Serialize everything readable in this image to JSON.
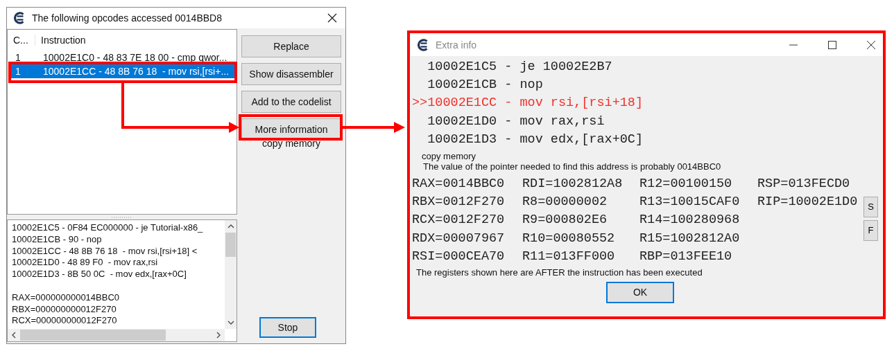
{
  "opcodes_window": {
    "title": "The following opcodes accessed 0014BBD8",
    "columns": [
      "C...",
      "Instruction"
    ],
    "rows": [
      {
        "count": "1",
        "instruction": "10002E1C0 - 48 83 7E 18 00 - cmp qwor...",
        "selected": false
      },
      {
        "count": "1",
        "instruction": "10002E1CC - 48 8B 76 18  - mov rsi,[rsi+...",
        "selected": true
      }
    ],
    "buttons": [
      "Replace",
      "Show disassembler",
      "Add to the codelist",
      "More information"
    ],
    "copy_memory": "copy memory",
    "details": [
      "10002E1C5 - 0F84 EC000000 - je Tutorial-x86_",
      "10002E1CB - 90 - nop",
      "10002E1CC - 48 8B 76 18  - mov rsi,[rsi+18] <",
      "10002E1D0 - 48 89 F0  - mov rax,rsi",
      "10002E1D3 - 8B 50 0C  - mov edx,[rax+0C]"
    ],
    "detail_registers": [
      "RAX=000000000014BBC0",
      "RBX=000000000012F270",
      "RCX=000000000012F270"
    ],
    "stop_button": "Stop"
  },
  "extra_info_window": {
    "title": "Extra info",
    "code_lines": [
      {
        "text": "10002E1C5 - je 10002E2B7",
        "current": false
      },
      {
        "text": "10002E1CB - nop",
        "current": false
      },
      {
        "prefix": ">>",
        "text": "10002E1CC - mov rsi,[rsi+18]",
        "current": true
      },
      {
        "text": "10002E1D0 - mov rax,rsi",
        "current": false
      },
      {
        "text": "10002E1D3 - mov edx,[rax+0C]",
        "current": false
      }
    ],
    "copy_memory": "copy memory",
    "pointer_note": "The value of the pointer needed to find this address is probably 0014BBC0",
    "registers": [
      [
        "RAX=0014BBC0",
        "RDI=1002812A8",
        "R12=00100150",
        "RSP=013FECD0"
      ],
      [
        "RBX=0012F270",
        "R8=00000002",
        "R13=10015CAF0",
        "RIP=10002E1D0"
      ],
      [
        "RCX=0012F270",
        "R9=000802E6",
        "R14=100280968"
      ],
      [
        "RDX=00007967",
        "R10=00080552",
        "R15=1002812A0"
      ],
      [
        "RSI=000CEA70",
        "R11=013FF000",
        "RBP=013FEE10"
      ]
    ],
    "side_buttons": [
      "S",
      "F"
    ],
    "footer_note": "The registers shown here are AFTER the instruction has been executed",
    "ok_button": "OK"
  }
}
